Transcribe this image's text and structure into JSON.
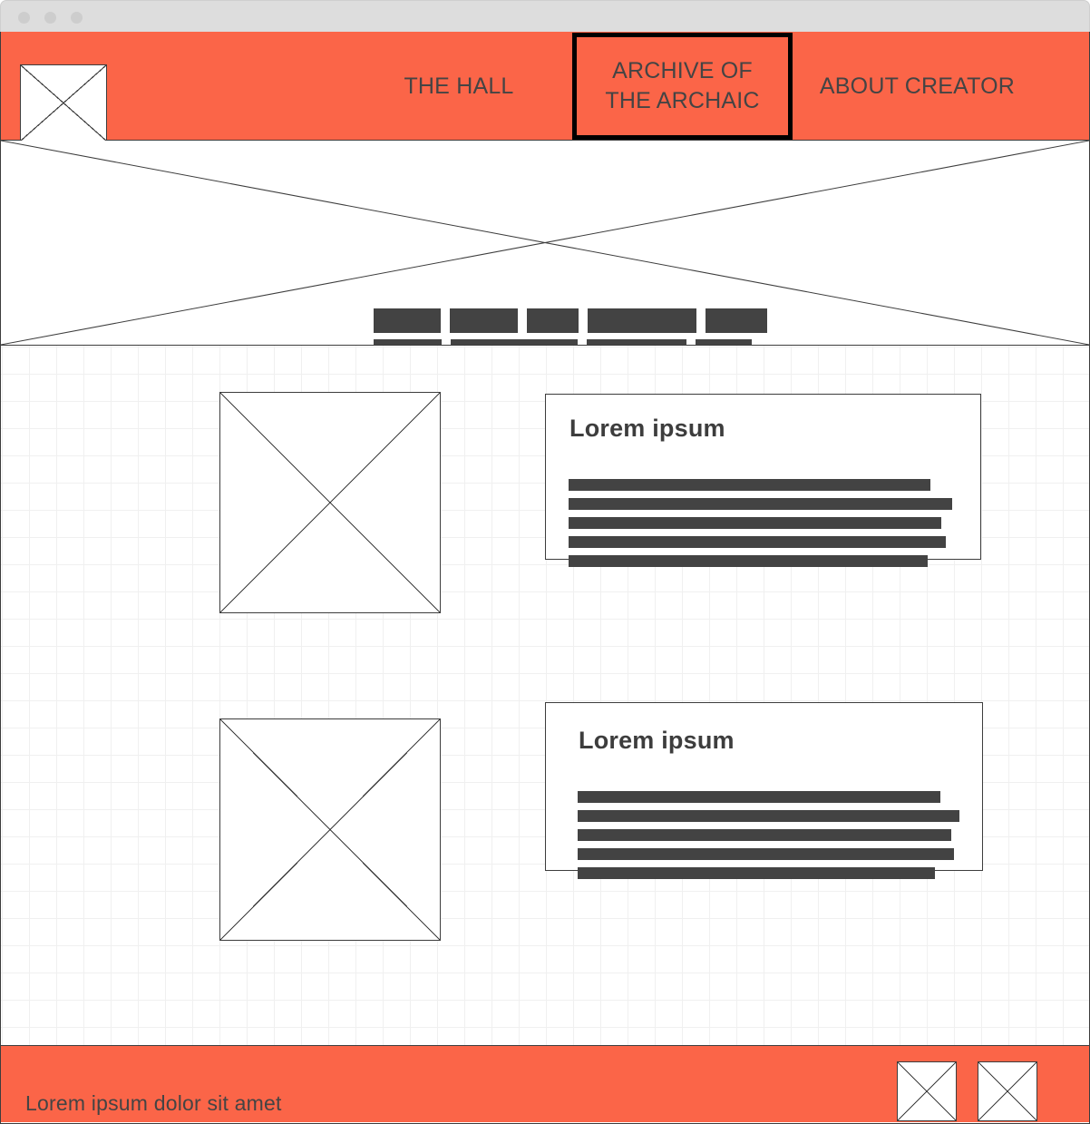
{
  "window": {
    "traffic_lights": [
      "close-dot",
      "minimize-dot",
      "maximize-dot"
    ]
  },
  "header": {
    "logo_alt": "site-logo-placeholder",
    "nav": [
      {
        "label": "THE HALL",
        "active": false
      },
      {
        "label": "ARCHIVE OF\nTHE ARCHAIC",
        "line1": "ARCHIVE OF",
        "line2": "THE ARCHAIC",
        "active": true
      },
      {
        "label": "ABOUT CREATOR",
        "active": false
      }
    ]
  },
  "hero": {
    "alt": "hero-image-placeholder",
    "heading_blocks": {
      "row1": [
        74,
        75,
        57,
        120,
        68
      ],
      "row2": [
        75,
        140,
        110,
        62
      ]
    }
  },
  "main": {
    "sections": [
      {
        "image_alt": "content-image-placeholder-1",
        "title": "Lorem ipsum",
        "line_widths": [
          399,
          423,
          411,
          416,
          396
        ]
      },
      {
        "image_alt": "content-image-placeholder-2",
        "title": "Lorem ipsum",
        "line_widths": [
          400,
          421,
          412,
          415,
          394
        ]
      }
    ]
  },
  "footer": {
    "text": "Lorem ipsum dolor sit amet",
    "icons": [
      "footer-image-placeholder-1",
      "footer-image-placeholder-2"
    ]
  },
  "colors": {
    "accent": "#fb6548",
    "ink": "#3d3d3d",
    "placeholder_fill": "#434343",
    "chrome": "#dddddd",
    "grid_minor": "#f0f0f0",
    "grid_major": "#e2e2e2"
  }
}
